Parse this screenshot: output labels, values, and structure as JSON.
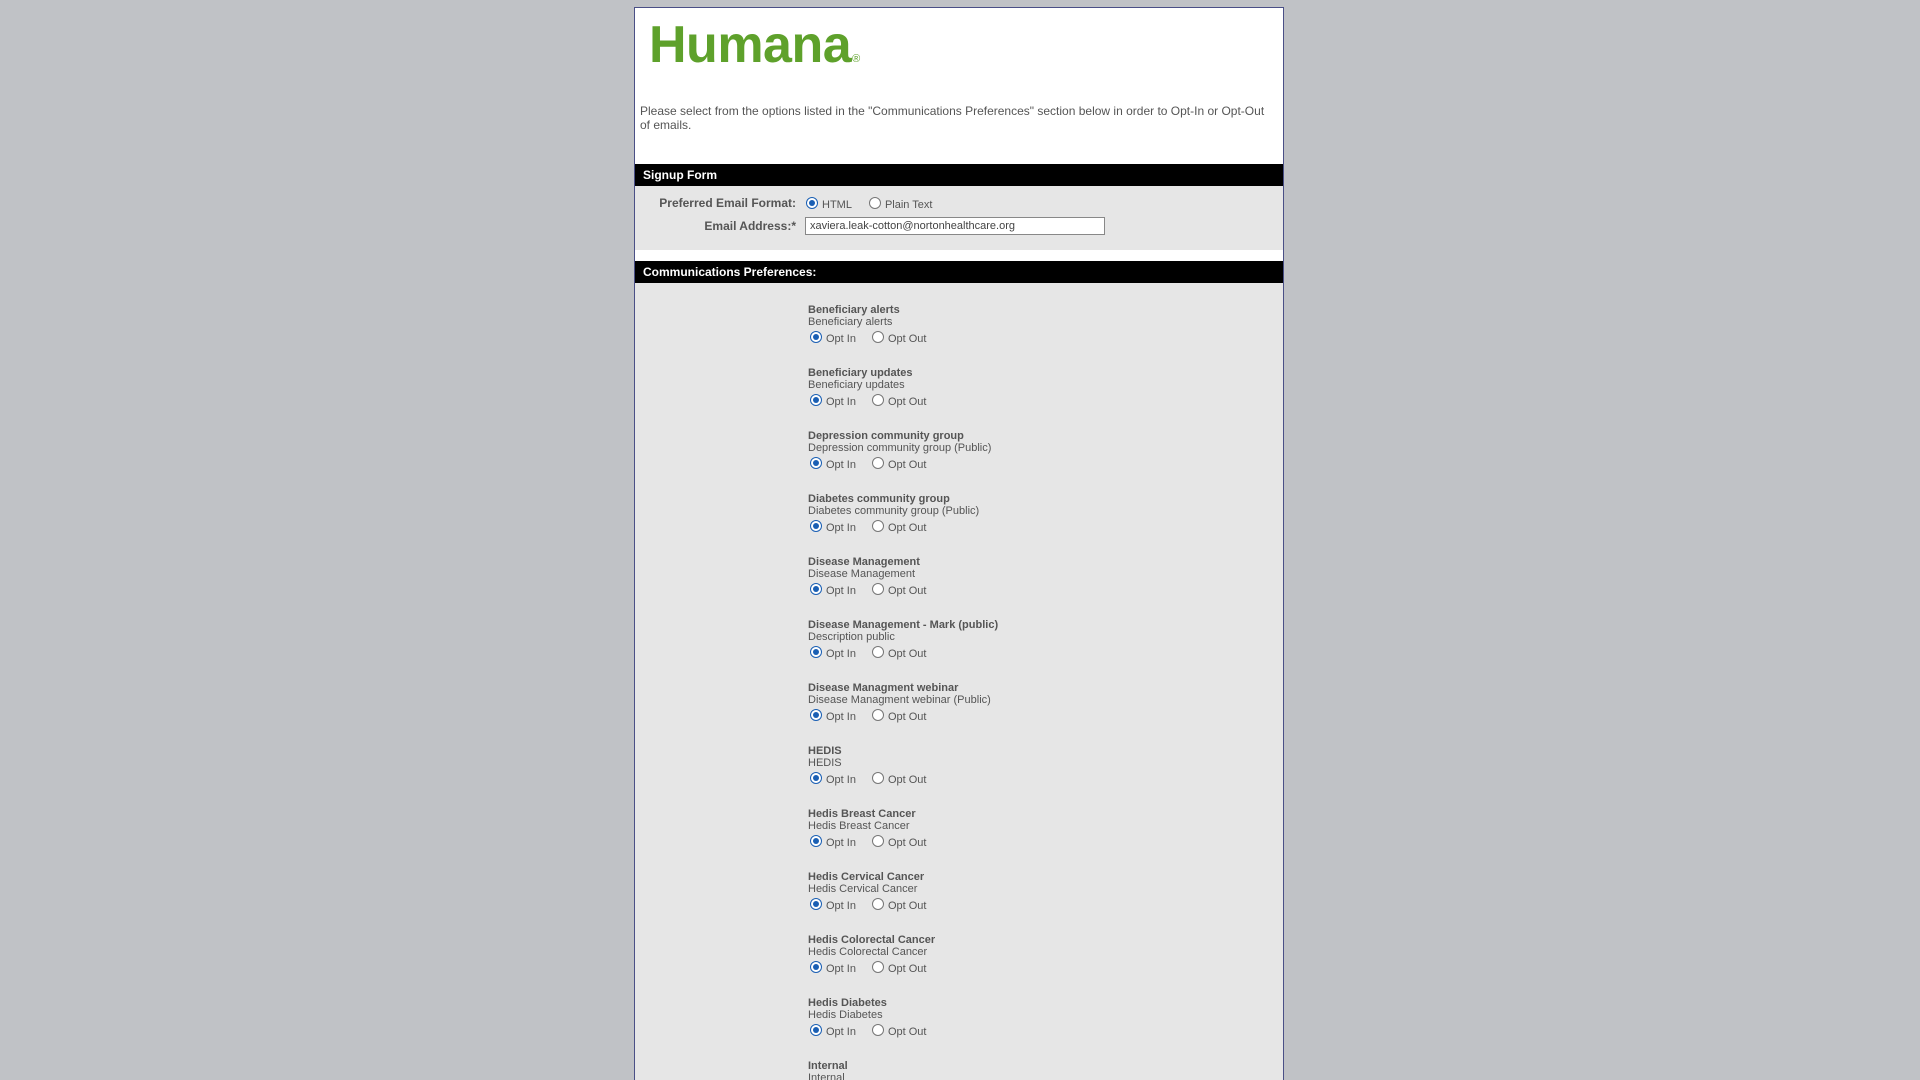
{
  "brand": {
    "logo_text": "Humana",
    "logo_mark": "®",
    "color": "#5ea12b"
  },
  "intro_text": "Please select from the options listed in the \"Communications Preferences\" section below in order to Opt-In or Opt-Out of emails.",
  "signup": {
    "header": "Signup Form",
    "format_label": "Preferred Email Format:",
    "format_options": [
      "HTML",
      "Plain Text"
    ],
    "format_selected": "HTML",
    "email_label": "Email Address:*",
    "email_value": "xaviera.leak-cotton@nortonhealthcare.org"
  },
  "communications": {
    "header": "Communications Preferences:",
    "opt_in_label": "Opt In",
    "opt_out_label": "Opt Out",
    "items": [
      {
        "title": "Beneficiary alerts",
        "description": "Beneficiary alerts",
        "selected": "in"
      },
      {
        "title": "Beneficiary updates",
        "description": "Beneficiary updates",
        "selected": "in"
      },
      {
        "title": "Depression community group",
        "description": "Depression community group (Public)",
        "selected": "in"
      },
      {
        "title": "Diabetes community group",
        "description": "Diabetes community group (Public)",
        "selected": "in"
      },
      {
        "title": "Disease Management",
        "description": "Disease Management",
        "selected": "in"
      },
      {
        "title": "Disease Management - Mark (public)",
        "description": "Description public",
        "selected": "in"
      },
      {
        "title": "Disease Managment webinar",
        "description": "Disease Managment webinar (Public)",
        "selected": "in"
      },
      {
        "title": "HEDIS",
        "description": "HEDIS",
        "selected": "in"
      },
      {
        "title": "Hedis Breast Cancer",
        "description": "Hedis Breast Cancer",
        "selected": "in"
      },
      {
        "title": "Hedis Cervical Cancer",
        "description": "Hedis Cervical Cancer",
        "selected": "in"
      },
      {
        "title": "Hedis Colorectal Cancer",
        "description": "Hedis Colorectal Cancer",
        "selected": "in"
      },
      {
        "title": "Hedis Diabetes",
        "description": "Hedis Diabetes",
        "selected": "in"
      },
      {
        "title": "Internal",
        "description": "Internal",
        "selected": "in"
      }
    ]
  }
}
